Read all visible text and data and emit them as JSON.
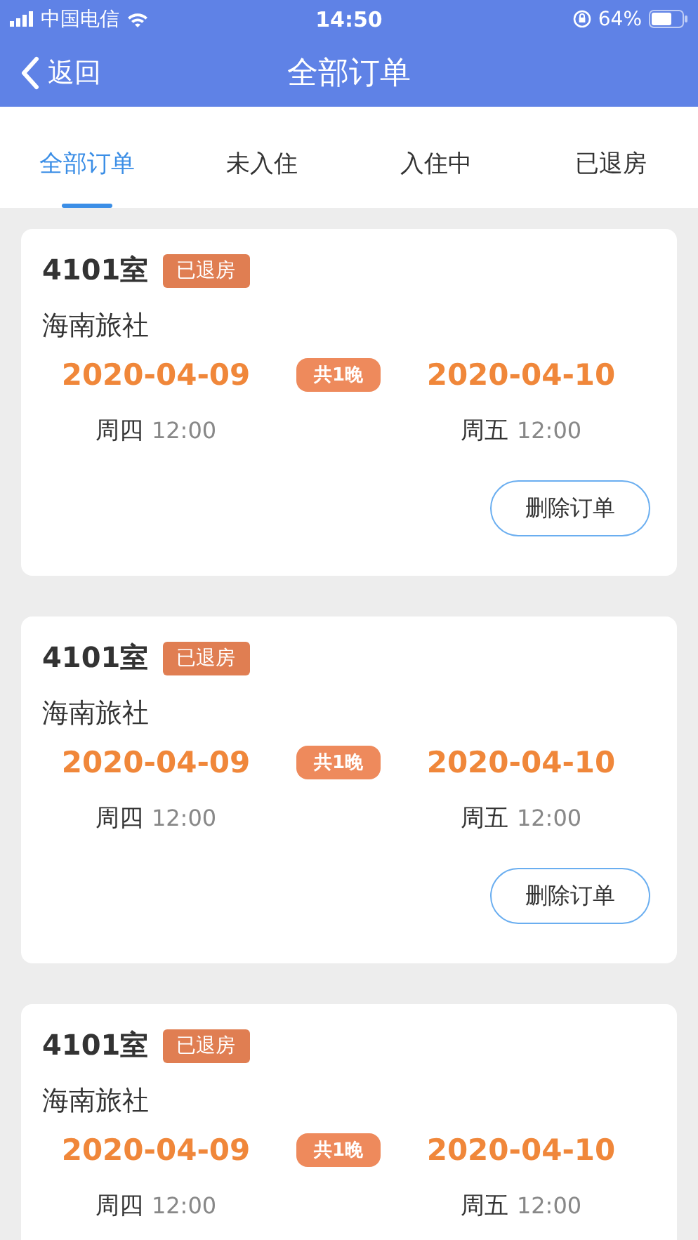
{
  "status_bar": {
    "carrier": "中国电信",
    "time": "14:50",
    "battery": "64%"
  },
  "nav": {
    "back": "返回",
    "title": "全部订单"
  },
  "tabs": [
    {
      "label": "全部订单",
      "selected": true
    },
    {
      "label": "未入住",
      "selected": false
    },
    {
      "label": "入住中",
      "selected": false
    },
    {
      "label": "已退房",
      "selected": false
    }
  ],
  "orders": [
    {
      "room": "4101室",
      "status": "已退房",
      "hotel": "海南旅社",
      "checkin_date": "2020-04-09",
      "nights": "共1晚",
      "checkout_date": "2020-04-10",
      "checkin_day": "周四",
      "checkin_time": "12:00",
      "checkout_day": "周五",
      "checkout_time": "12:00",
      "action": "删除订单"
    },
    {
      "room": "4101室",
      "status": "已退房",
      "hotel": "海南旅社",
      "checkin_date": "2020-04-09",
      "nights": "共1晚",
      "checkout_date": "2020-04-10",
      "checkin_day": "周四",
      "checkin_time": "12:00",
      "checkout_day": "周五",
      "checkout_time": "12:00",
      "action": "删除订单"
    },
    {
      "room": "4101室",
      "status": "已退房",
      "hotel": "海南旅社",
      "checkin_date": "2020-04-09",
      "nights": "共1晚",
      "checkout_date": "2020-04-10",
      "checkin_day": "周四",
      "checkin_time": "12:00",
      "checkout_day": "周五",
      "checkout_time": "12:00"
    }
  ]
}
